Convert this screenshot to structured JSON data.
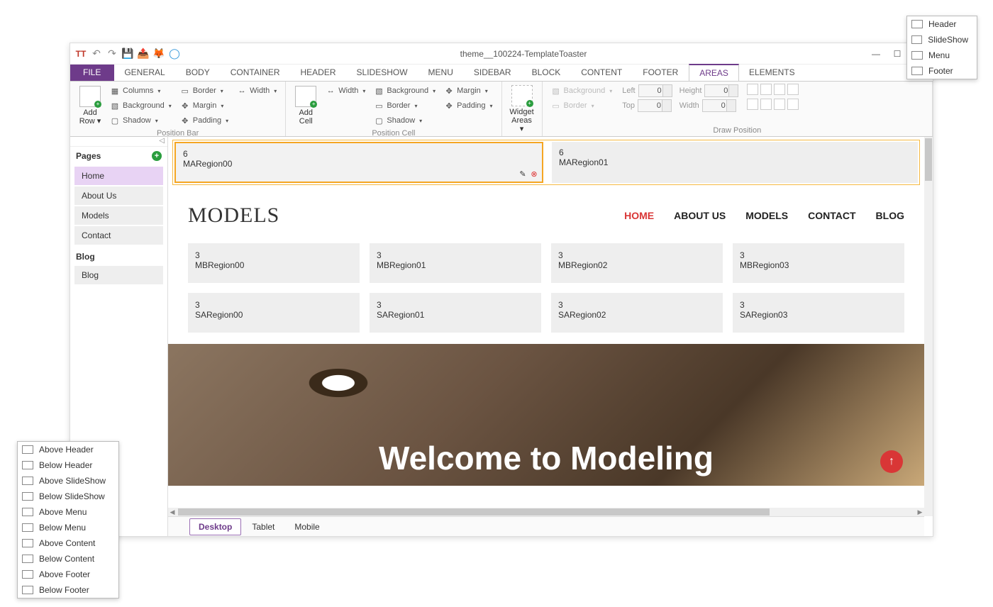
{
  "titlebar": {
    "title": "theme__100224-TemplateToaster"
  },
  "ribbon_tabs": [
    "FILE",
    "GENERAL",
    "BODY",
    "CONTAINER",
    "HEADER",
    "SLIDESHOW",
    "MENU",
    "SIDEBAR",
    "BLOCK",
    "CONTENT",
    "FOOTER",
    "AREAS",
    "ELEMENTS"
  ],
  "ribbon_active": "AREAS",
  "ribbon": {
    "position_bar": {
      "label": "Position Bar",
      "add_row": "Add Row",
      "columns": "Columns",
      "background": "Background",
      "shadow": "Shadow",
      "border": "Border",
      "margin": "Margin",
      "padding": "Padding",
      "width": "Width"
    },
    "position_cell": {
      "label": "Position Cell",
      "add_cell": "Add Cell",
      "width": "Width",
      "background": "Background",
      "border": "Border",
      "shadow": "Shadow",
      "margin": "Margin",
      "padding": "Padding"
    },
    "widget_areas": {
      "label": "Widget Areas"
    },
    "draw_position": {
      "label": "Draw Position",
      "background": "Background",
      "border": "Border",
      "left": "Left",
      "top": "Top",
      "height": "Height",
      "width": "Width",
      "left_val": "0",
      "top_val": "0",
      "height_val": "0",
      "width_val": "0"
    }
  },
  "sidebar": {
    "pages_label": "Pages",
    "blog_label": "Blog",
    "pages": [
      "Home",
      "About Us",
      "Models",
      "Contact"
    ],
    "blog_items": [
      "Blog"
    ],
    "active": "Home"
  },
  "canvas": {
    "ma": [
      {
        "num": "6",
        "name": "MARegion00",
        "selected": true
      },
      {
        "num": "6",
        "name": "MARegion01",
        "selected": false
      }
    ],
    "logo": "MODELS",
    "nav": [
      "HOME",
      "ABOUT US",
      "MODELS",
      "CONTACT",
      "BLOG"
    ],
    "nav_active": "HOME",
    "mb": [
      {
        "num": "3",
        "name": "MBRegion00"
      },
      {
        "num": "3",
        "name": "MBRegion01"
      },
      {
        "num": "3",
        "name": "MBRegion02"
      },
      {
        "num": "3",
        "name": "MBRegion03"
      }
    ],
    "sa": [
      {
        "num": "3",
        "name": "SARegion00"
      },
      {
        "num": "3",
        "name": "SARegion01"
      },
      {
        "num": "3",
        "name": "SARegion02"
      },
      {
        "num": "3",
        "name": "SARegion03"
      }
    ],
    "hero_title": "Welcome to Modeling"
  },
  "device_tabs": [
    "Desktop",
    "Tablet",
    "Mobile"
  ],
  "device_active": "Desktop",
  "popup_left": [
    "Above Header",
    "Below Header",
    "Above SlideShow",
    "Below SlideShow",
    "Above Menu",
    "Below Menu",
    "Above Content",
    "Below Content",
    "Above Footer",
    "Below Footer"
  ],
  "popup_right": [
    "Header",
    "SlideShow",
    "Menu",
    "Footer"
  ]
}
